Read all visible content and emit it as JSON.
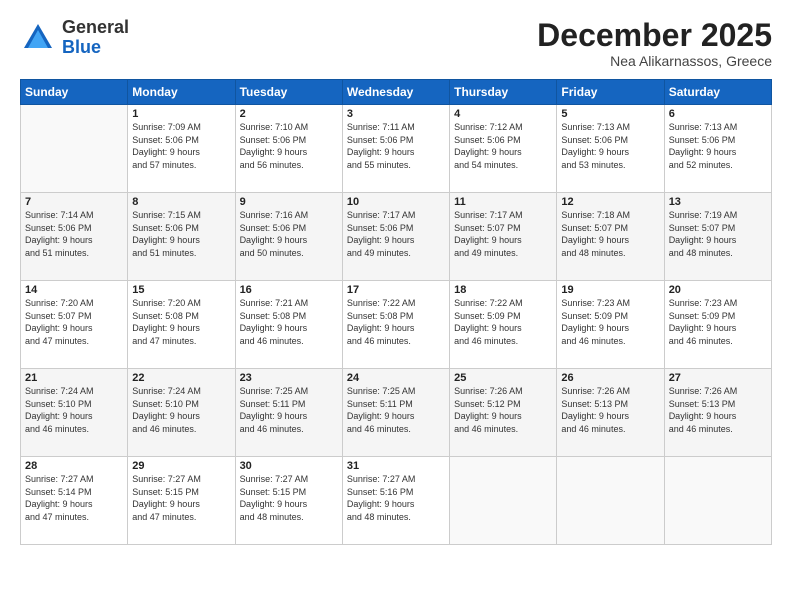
{
  "logo": {
    "general": "General",
    "blue": "Blue"
  },
  "title": "December 2025",
  "subtitle": "Nea Alikarnassos, Greece",
  "days_of_week": [
    "Sunday",
    "Monday",
    "Tuesday",
    "Wednesday",
    "Thursday",
    "Friday",
    "Saturday"
  ],
  "weeks": [
    [
      {
        "day": "",
        "info": ""
      },
      {
        "day": "1",
        "info": "Sunrise: 7:09 AM\nSunset: 5:06 PM\nDaylight: 9 hours\nand 57 minutes."
      },
      {
        "day": "2",
        "info": "Sunrise: 7:10 AM\nSunset: 5:06 PM\nDaylight: 9 hours\nand 56 minutes."
      },
      {
        "day": "3",
        "info": "Sunrise: 7:11 AM\nSunset: 5:06 PM\nDaylight: 9 hours\nand 55 minutes."
      },
      {
        "day": "4",
        "info": "Sunrise: 7:12 AM\nSunset: 5:06 PM\nDaylight: 9 hours\nand 54 minutes."
      },
      {
        "day": "5",
        "info": "Sunrise: 7:13 AM\nSunset: 5:06 PM\nDaylight: 9 hours\nand 53 minutes."
      },
      {
        "day": "6",
        "info": "Sunrise: 7:13 AM\nSunset: 5:06 PM\nDaylight: 9 hours\nand 52 minutes."
      }
    ],
    [
      {
        "day": "7",
        "info": "Sunrise: 7:14 AM\nSunset: 5:06 PM\nDaylight: 9 hours\nand 51 minutes."
      },
      {
        "day": "8",
        "info": "Sunrise: 7:15 AM\nSunset: 5:06 PM\nDaylight: 9 hours\nand 51 minutes."
      },
      {
        "day": "9",
        "info": "Sunrise: 7:16 AM\nSunset: 5:06 PM\nDaylight: 9 hours\nand 50 minutes."
      },
      {
        "day": "10",
        "info": "Sunrise: 7:17 AM\nSunset: 5:06 PM\nDaylight: 9 hours\nand 49 minutes."
      },
      {
        "day": "11",
        "info": "Sunrise: 7:17 AM\nSunset: 5:07 PM\nDaylight: 9 hours\nand 49 minutes."
      },
      {
        "day": "12",
        "info": "Sunrise: 7:18 AM\nSunset: 5:07 PM\nDaylight: 9 hours\nand 48 minutes."
      },
      {
        "day": "13",
        "info": "Sunrise: 7:19 AM\nSunset: 5:07 PM\nDaylight: 9 hours\nand 48 minutes."
      }
    ],
    [
      {
        "day": "14",
        "info": "Sunrise: 7:20 AM\nSunset: 5:07 PM\nDaylight: 9 hours\nand 47 minutes."
      },
      {
        "day": "15",
        "info": "Sunrise: 7:20 AM\nSunset: 5:08 PM\nDaylight: 9 hours\nand 47 minutes."
      },
      {
        "day": "16",
        "info": "Sunrise: 7:21 AM\nSunset: 5:08 PM\nDaylight: 9 hours\nand 46 minutes."
      },
      {
        "day": "17",
        "info": "Sunrise: 7:22 AM\nSunset: 5:08 PM\nDaylight: 9 hours\nand 46 minutes."
      },
      {
        "day": "18",
        "info": "Sunrise: 7:22 AM\nSunset: 5:09 PM\nDaylight: 9 hours\nand 46 minutes."
      },
      {
        "day": "19",
        "info": "Sunrise: 7:23 AM\nSunset: 5:09 PM\nDaylight: 9 hours\nand 46 minutes."
      },
      {
        "day": "20",
        "info": "Sunrise: 7:23 AM\nSunset: 5:09 PM\nDaylight: 9 hours\nand 46 minutes."
      }
    ],
    [
      {
        "day": "21",
        "info": "Sunrise: 7:24 AM\nSunset: 5:10 PM\nDaylight: 9 hours\nand 46 minutes."
      },
      {
        "day": "22",
        "info": "Sunrise: 7:24 AM\nSunset: 5:10 PM\nDaylight: 9 hours\nand 46 minutes."
      },
      {
        "day": "23",
        "info": "Sunrise: 7:25 AM\nSunset: 5:11 PM\nDaylight: 9 hours\nand 46 minutes."
      },
      {
        "day": "24",
        "info": "Sunrise: 7:25 AM\nSunset: 5:11 PM\nDaylight: 9 hours\nand 46 minutes."
      },
      {
        "day": "25",
        "info": "Sunrise: 7:26 AM\nSunset: 5:12 PM\nDaylight: 9 hours\nand 46 minutes."
      },
      {
        "day": "26",
        "info": "Sunrise: 7:26 AM\nSunset: 5:13 PM\nDaylight: 9 hours\nand 46 minutes."
      },
      {
        "day": "27",
        "info": "Sunrise: 7:26 AM\nSunset: 5:13 PM\nDaylight: 9 hours\nand 46 minutes."
      }
    ],
    [
      {
        "day": "28",
        "info": "Sunrise: 7:27 AM\nSunset: 5:14 PM\nDaylight: 9 hours\nand 47 minutes."
      },
      {
        "day": "29",
        "info": "Sunrise: 7:27 AM\nSunset: 5:15 PM\nDaylight: 9 hours\nand 47 minutes."
      },
      {
        "day": "30",
        "info": "Sunrise: 7:27 AM\nSunset: 5:15 PM\nDaylight: 9 hours\nand 48 minutes."
      },
      {
        "day": "31",
        "info": "Sunrise: 7:27 AM\nSunset: 5:16 PM\nDaylight: 9 hours\nand 48 minutes."
      },
      {
        "day": "",
        "info": ""
      },
      {
        "day": "",
        "info": ""
      },
      {
        "day": "",
        "info": ""
      }
    ]
  ]
}
